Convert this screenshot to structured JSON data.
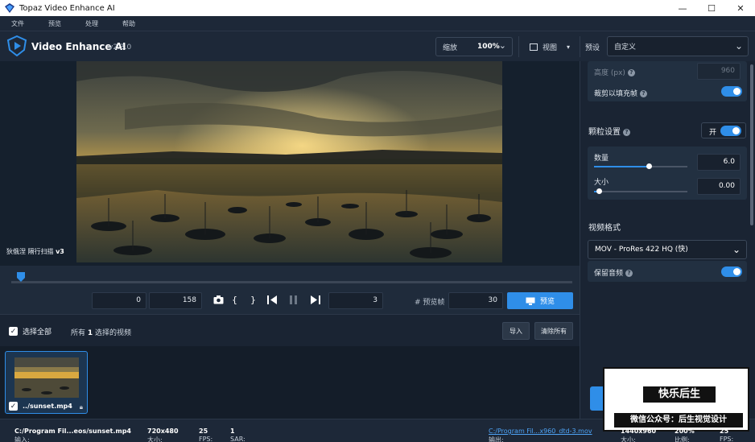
{
  "window": {
    "title": "Topaz Video Enhance AI",
    "minimize": "—",
    "maximize": "☐",
    "close": "✕"
  },
  "menu": [
    "文件",
    "预览",
    "处理",
    "帮助"
  ],
  "header": {
    "app_name": "Video Enhance AI",
    "version": "v2.3.0",
    "zoom_label": "缩放",
    "zoom_value": "100%",
    "view_label": "视图",
    "preset_label": "预设",
    "preset_value": "自定义"
  },
  "preview": {
    "model_prefix": "狄俄涅 隔行扫描",
    "model_version": "v3"
  },
  "timeline": {
    "position": 0.01
  },
  "controls": {
    "start_frame": "0",
    "end_frame": "158",
    "step_frame": "3",
    "preview_frames_label": "# 预览帧",
    "preview_frames": "30",
    "preview_button": "预览"
  },
  "list": {
    "select_all": "选择全部",
    "selection_prefix": "所有",
    "selection_count": "1",
    "selection_suffix": "选择的视频",
    "import_button": "导入",
    "clear_button": "清除所有"
  },
  "queue": [
    {
      "name": "../sunset.mp4",
      "checked": true
    }
  ],
  "status": {
    "input_label": "输入:",
    "input_path": "C:/Program Fil...eos/sunset.mp4",
    "size_label": "大小:",
    "size_value": "720x480",
    "fps_label": "FPS:",
    "fps_value": "25",
    "sar_label": "SAR:",
    "sar_value": "1",
    "output_label": "输出:",
    "output_path": "C:/Program Fil...x960_dtd-3.mov",
    "out_size_label": "大小:",
    "out_size_value": "1440x960",
    "ratio_label": "比例:",
    "ratio_value": "200%",
    "out_fps_label": "FPS:",
    "out_fps_value": "25"
  },
  "panel": {
    "height_label": "高度 (px)",
    "height_value": "960",
    "crop_label": "裁剪以填充帧",
    "grain_title": "颗粒设置",
    "grain_toggle_label": "开",
    "amount_label": "数量",
    "amount_value": "6.0",
    "amount_fraction": 0.59,
    "size_label": "大小",
    "size_value": "0.00",
    "size_fraction": 0.05,
    "format_title": "视频格式",
    "format_value": "MOV  - ProRes 422 HQ (快)",
    "audio_label": "保留音频"
  },
  "watermark": {
    "line1": "快乐后生",
    "line2": "微信公众号：后生视觉设计"
  },
  "colors": {
    "accent": "#2f8ee8",
    "background": "#1a2433"
  }
}
